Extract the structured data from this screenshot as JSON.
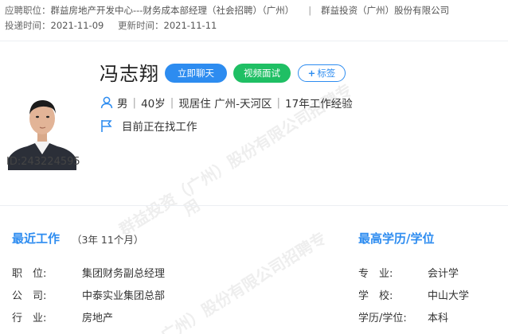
{
  "top": {
    "position_label": "应聘职位：",
    "position_value": "群益房地产开发中心---财务成本部经理（社会招聘）（广州）",
    "company": "群益投资（广州）股份有限公司",
    "delivered_label": "投递时间：",
    "delivered_value": "2021-11-09",
    "updated_label": "更新时间：",
    "updated_value": "2021-11-11"
  },
  "candidate": {
    "name": "冯志翔",
    "id": "ID:243224595",
    "gender": "男",
    "age": "40岁",
    "residence_label": "现居住",
    "residence": "广州-天河区",
    "experience": "17年工作经验",
    "job_status": "目前正在找工作"
  },
  "actions": {
    "chat": "立即聊天",
    "video": "视频面试",
    "tag": "标签"
  },
  "work": {
    "title": "最近工作",
    "duration": "（3年 11个月）",
    "fields": [
      {
        "label": "职　位:",
        "value": "集团财务副总经理"
      },
      {
        "label": "公　司:",
        "value": "中泰实业集团总部"
      },
      {
        "label": "行　业:",
        "value": "房地产"
      }
    ]
  },
  "education": {
    "title": "最高学历/学位",
    "fields": [
      {
        "label": "专　业:",
        "value": "会计学"
      },
      {
        "label": "学　校:",
        "value": "中山大学"
      },
      {
        "label": "学历/学位:",
        "value": "本科"
      }
    ]
  },
  "watermark": "群益投资（广州）股份有限公司招聘专用",
  "colors": {
    "accent": "#2d8cf0",
    "video": "#1fbf64"
  },
  "icons": {
    "gender_age": "person-icon",
    "status": "flag-icon",
    "tag": "plus-icon"
  }
}
